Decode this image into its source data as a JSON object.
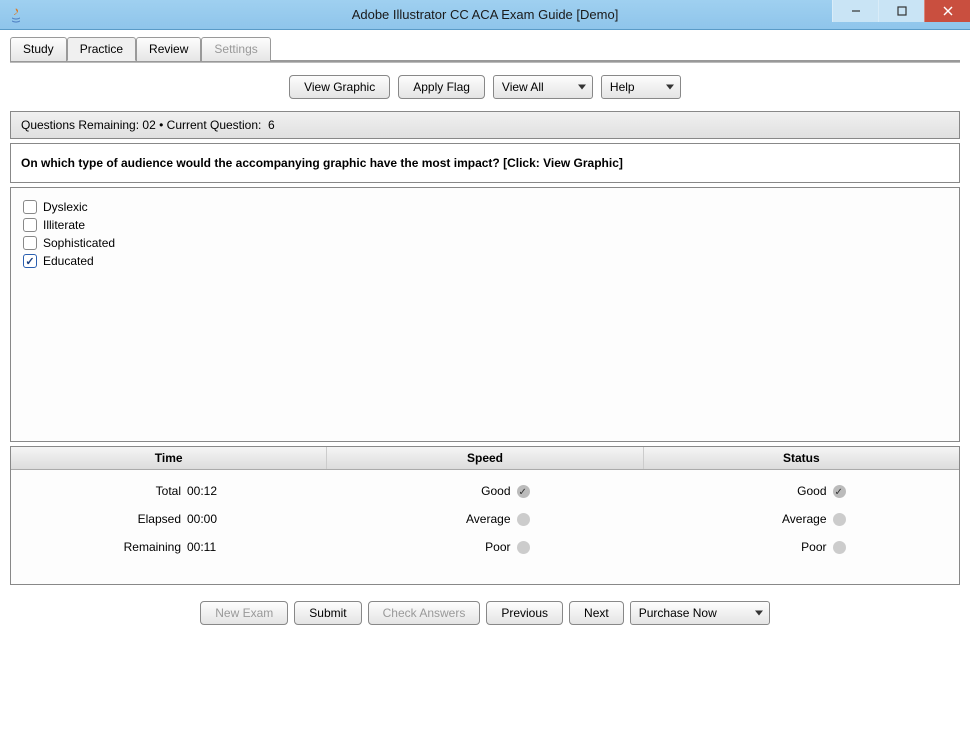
{
  "window": {
    "title": "Adobe Illustrator CC ACA Exam Guide [Demo]"
  },
  "tabs": [
    {
      "label": "Study",
      "active": false,
      "disabled": false
    },
    {
      "label": "Practice",
      "active": true,
      "disabled": false
    },
    {
      "label": "Review",
      "active": false,
      "disabled": false
    },
    {
      "label": "Settings",
      "active": false,
      "disabled": true
    }
  ],
  "toolbar": {
    "view_graphic": "View Graphic",
    "apply_flag": "Apply Flag",
    "view_filter": "View All",
    "help": "Help"
  },
  "status": {
    "remaining_label": "Questions Remaining:",
    "remaining_value": "02",
    "separator": "•",
    "current_label": "Current Question:",
    "current_value": "6"
  },
  "question": "On which type of audience would the accompanying graphic have the most impact? [Click: View Graphic]",
  "answers": [
    {
      "label": "Dyslexic",
      "checked": false
    },
    {
      "label": "Illiterate",
      "checked": false
    },
    {
      "label": "Sophisticated",
      "checked": false
    },
    {
      "label": "Educated",
      "checked": true
    }
  ],
  "stats": {
    "headers": {
      "time": "Time",
      "speed": "Speed",
      "status": "Status"
    },
    "time": {
      "total_label": "Total",
      "total_value": "00:12",
      "elapsed_label": "Elapsed",
      "elapsed_value": "00:00",
      "remaining_label": "Remaining",
      "remaining_value": "00:11"
    },
    "speed": {
      "good": "Good",
      "average": "Average",
      "poor": "Poor",
      "selected": "good"
    },
    "status_col": {
      "good": "Good",
      "average": "Average",
      "poor": "Poor",
      "selected": "good"
    }
  },
  "bottom": {
    "new_exam": "New Exam",
    "submit": "Submit",
    "check_answers": "Check Answers",
    "previous": "Previous",
    "next": "Next",
    "purchase": "Purchase Now"
  }
}
